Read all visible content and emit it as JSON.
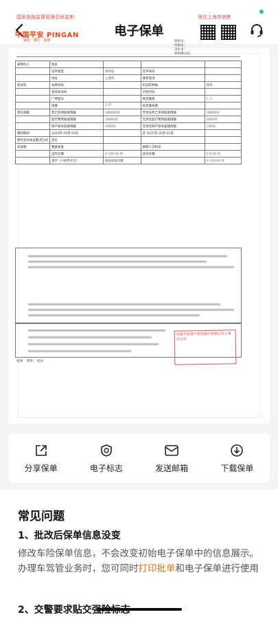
{
  "colors": {
    "status_dot": "#33c36b",
    "accent": "#e8761b",
    "brand": "#e8471b",
    "stamp": "#dd3333"
  },
  "header": {
    "title": "电子保单",
    "back_icon": "chevron-left-icon",
    "service_icon": "headset-icon"
  },
  "document": {
    "head_left": "国家金融监督管理总局监制",
    "head_right": "限在上海市销售",
    "brand": "中国平安 PINGAN",
    "brand_sub": "保险 · 银行 · 投资",
    "meta": [
      "保单号：",
      "印刷号：",
      "流水号：",
      "保单确认码："
    ],
    "rows": [
      [
        "被保险人",
        "姓名",
        "",
        "",
        ""
      ],
      [
        "",
        "证件类型",
        "身份证",
        "证件号码",
        ""
      ],
      [
        "",
        "地址",
        "上海市",
        "联系电话",
        ""
      ],
      [
        "机动车",
        "号牌号码",
        "",
        "机动车种类",
        "客车"
      ],
      [
        "",
        "发动机号码",
        "",
        "识别代码",
        ""
      ],
      [
        "",
        "厂牌型号",
        "",
        "核定载客",
        "5 人"
      ],
      [
        "",
        "排量",
        "1.5T",
        "核定载质量",
        ""
      ],
      [
        "责任限额",
        "死亡伤残赔偿限额",
        "180000元",
        "无责任死亡伤残赔偿限额",
        "18000元"
      ],
      [
        "",
        "医疗费用赔偿限额",
        "18000元",
        "无责任医疗费用赔偿限额",
        "1800元"
      ],
      [
        "",
        "财产损失赔偿限额",
        "2000元",
        "无责任财产损失赔偿限额",
        "100元"
      ],
      [
        "保险期间",
        "2024年 02月 03日",
        "",
        "至 2025年 02月 02日",
        ""
      ],
      [
        "保险合同争议解决方式",
        "诉讼",
        "",
        "",
        ""
      ],
      [
        "车船税",
        "整备质量",
        "",
        "纳税人识别号",
        ""
      ],
      [
        "",
        "当年应缴",
        "¥ 150.00 元",
        "往年补缴",
        "¥ 0.00 元"
      ],
      [
        "",
        "合计（人民币大写）",
        "壹佰伍拾元整",
        "",
        "¥ 150.00 元"
      ]
    ],
    "foot": "核保：      制单：      经办：",
    "stamp_text": "中国平安财产保险股份有限公司上海分公司"
  },
  "actions": [
    {
      "label": "分享保单",
      "icon": "share-icon"
    },
    {
      "label": "电子标志",
      "icon": "badge-icon"
    },
    {
      "label": "发送邮箱",
      "icon": "mail-icon"
    },
    {
      "label": "下载保单",
      "icon": "download-icon"
    }
  ],
  "faq": {
    "heading": "常见问题",
    "q1": "1、批改后保单信息没变",
    "a1_part1": "修改车险保单信息，不会改变初始电子保单中的信息展示。办理车驾管业务时，您可同时",
    "a1_link": "打印批单",
    "a1_part2": "和电子保单进行使用",
    "q2": "2、交警要求贴交强险标志"
  }
}
